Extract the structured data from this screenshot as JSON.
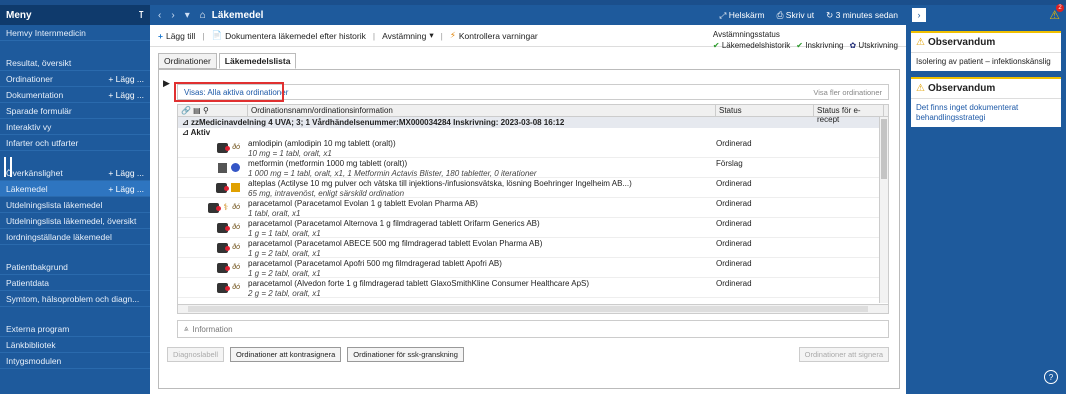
{
  "sidebar": {
    "title": "Meny",
    "items": [
      {
        "label": "Hemvy Internmedicin"
      },
      {
        "label": "Resultat, översikt"
      },
      {
        "label": "Ordinationer",
        "add": "+ Lägg ..."
      },
      {
        "label": "Dokumentation",
        "add": "+ Lägg ..."
      },
      {
        "label": "Sparade formulär"
      },
      {
        "label": "Interaktiv vy"
      },
      {
        "label": "Infarter och utfarter"
      },
      {
        "label": "Överkänslighet",
        "add": "+ Lägg ..."
      },
      {
        "label": "Läkemedel",
        "add": "+ Lägg ..."
      },
      {
        "label": "Utdelningslista läkemedel"
      },
      {
        "label": "Utdelningslista läkemedel, översikt"
      },
      {
        "label": "Iordningställande läkemedel"
      },
      {
        "label": "Patientbakgrund"
      },
      {
        "label": "Patientdata"
      },
      {
        "label": "Symtom, hälsoproblem och diagn..."
      },
      {
        "label": "Externa program"
      },
      {
        "label": "Länkbibliotek"
      },
      {
        "label": "Intygsmodulen"
      }
    ]
  },
  "header": {
    "title": "Läkemedel",
    "fullscreen": "Helskärm",
    "print": "Skriv ut",
    "refresh": "3 minutes sedan"
  },
  "toolbar": {
    "add": "Lägg till",
    "document_history": "Dokumentera läkemedel efter historik",
    "reconcile": "Avstämning",
    "check_warnings": "Kontrollera varningar"
  },
  "reconciliation": {
    "title": "Avstämningsstatus",
    "history": "Läkemedelshistorik",
    "admission": "Inskrivning",
    "discharge": "Utskrivning"
  },
  "tabs": {
    "orders": "Ordinationer",
    "medlist": "Läkemedelslista"
  },
  "filter": {
    "label": "Visas: Alla aktiva ordinationer",
    "more": "Visa fler ordinationer"
  },
  "grid": {
    "col_name": "Ordinationsnamn/ordinationsinformation",
    "col_status": "Status",
    "col_erecept": "Status för e-recept",
    "group": "zzMedicinavdelning 4 UVA; 3; 1  Vårdhändelsenummer:MX000034284  Inskrivning: 2023-03-08 16:12",
    "subgroup": "Aktiv",
    "rows": [
      {
        "name": "amlodipin (amlodipin 10 mg tablett (oralt))",
        "dose": "10 mg = 1 tabl, oralt, x1",
        "status": "Ordinerad"
      },
      {
        "name": "metformin (metformin 1000 mg tablett (oralt))",
        "dose": "1 000 mg = 1 tabl, oralt, x1, 1 Metformin Actavis Blister, 180 tabletter, 0 iterationer",
        "status": "Förslag"
      },
      {
        "name": "alteplas (Actilyse 10 mg pulver och vätska till injektions-/infusionsvätska, lösning Boehringer Ingelheim AB...)",
        "dose": "65 mg, intravenöst, enligt särskild ordination",
        "status": "Ordinerad"
      },
      {
        "name": "paracetamol (Paracetamol Evolan 1 g tablett Evolan Pharma AB)",
        "dose": "1 tabl, oralt, x1",
        "status": "Ordinerad"
      },
      {
        "name": "paracetamol (Paracetamol Alternova 1 g filmdragerad tablett Orifarm Generics AB)",
        "dose": "1 g = 1 tabl, oralt, x1",
        "status": "Ordinerad"
      },
      {
        "name": "paracetamol (Paracetamol ABECE 500 mg filmdragerad tablett Evolan Pharma AB)",
        "dose": "1 g = 2 tabl, oralt, x1",
        "status": "Ordinerad"
      },
      {
        "name": "paracetamol (Paracetamol Apofri 500 mg filmdragerad tablett Apofri AB)",
        "dose": "1 g = 2 tabl, oralt, x1",
        "status": "Ordinerad"
      },
      {
        "name": "paracetamol (Alvedon forte 1 g filmdragerad tablett GlaxoSmithKline Consumer Healthcare ApS)",
        "dose": "2 g = 2 tabl, oralt, x1",
        "status": "Ordinerad"
      }
    ]
  },
  "info": "Information",
  "buttons": {
    "diagnosis": "Diagnoslabell",
    "cosign": "Ordinationer att kontrasignera",
    "review": "Ordinationer för ssk-granskning",
    "sign": "Ordinationer att signera"
  },
  "right": {
    "badge": "2",
    "obs1_title": "Observandum",
    "obs1_body": "Isolering av patient – infektionskänslig",
    "obs2_title": "Observandum",
    "obs2_body": "Det finns inget dokumenterat behandlingsstrategi"
  }
}
